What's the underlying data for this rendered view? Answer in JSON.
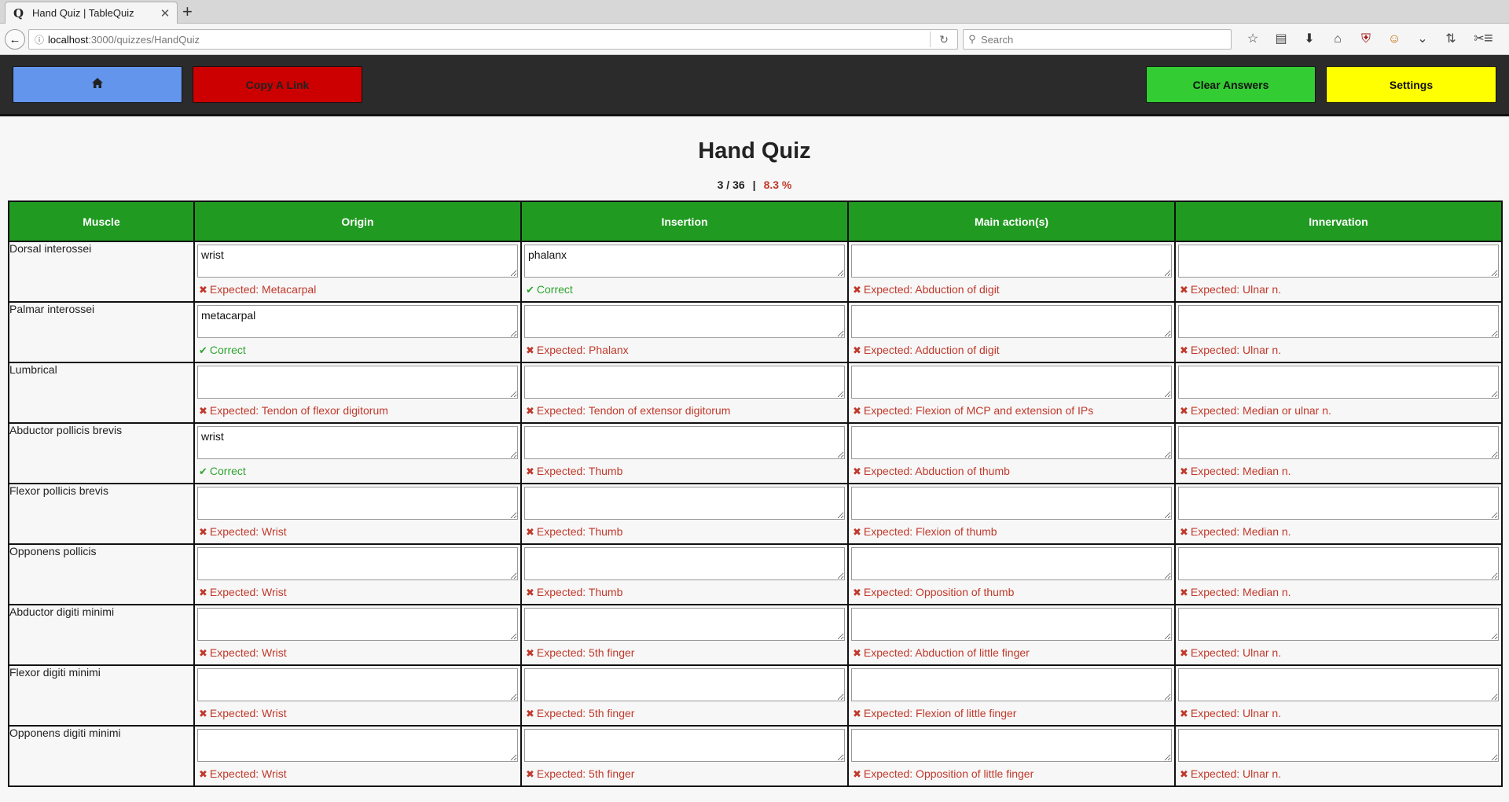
{
  "browser": {
    "tab_title": "Hand Quiz | TableQuiz",
    "tab_favicon": "Q",
    "url_host": "localhost",
    "url_path": ":3000/quizzes/HandQuiz",
    "search_placeholder": "Search"
  },
  "header": {
    "home_icon": "home-icon",
    "copy_label": "Copy A Link",
    "clear_label": "Clear Answers",
    "settings_label": "Settings"
  },
  "quiz": {
    "title": "Hand Quiz",
    "score": "3 / 36",
    "separator": "|",
    "percent": "8.3 %"
  },
  "table": {
    "columns": [
      "Muscle",
      "Origin",
      "Insertion",
      "Main action(s)",
      "Innervation"
    ],
    "rows": [
      {
        "muscle": "Dorsal interossei",
        "cells": [
          {
            "value": "wrist",
            "correct": false,
            "feedback": "Expected: Metacarpal"
          },
          {
            "value": "phalanx",
            "correct": true,
            "feedback": "Correct"
          },
          {
            "value": "",
            "correct": false,
            "feedback": "Expected: Abduction of digit"
          },
          {
            "value": "",
            "correct": false,
            "feedback": "Expected: Ulnar n."
          }
        ]
      },
      {
        "muscle": "Palmar interossei",
        "cells": [
          {
            "value": "metacarpal",
            "correct": true,
            "feedback": "Correct"
          },
          {
            "value": "",
            "correct": false,
            "feedback": "Expected: Phalanx"
          },
          {
            "value": "",
            "correct": false,
            "feedback": "Expected: Adduction of digit"
          },
          {
            "value": "",
            "correct": false,
            "feedback": "Expected: Ulnar n."
          }
        ]
      },
      {
        "muscle": "Lumbrical",
        "cells": [
          {
            "value": "",
            "correct": false,
            "feedback": "Expected: Tendon of flexor digitorum"
          },
          {
            "value": "",
            "correct": false,
            "feedback": "Expected: Tendon of extensor digitorum"
          },
          {
            "value": "",
            "correct": false,
            "feedback": "Expected: Flexion of MCP and extension of IPs"
          },
          {
            "value": "",
            "correct": false,
            "feedback": "Expected: Median or ulnar n."
          }
        ]
      },
      {
        "muscle": "Abductor pollicis brevis",
        "cells": [
          {
            "value": "wrist",
            "correct": true,
            "feedback": "Correct"
          },
          {
            "value": "",
            "correct": false,
            "feedback": "Expected: Thumb"
          },
          {
            "value": "",
            "correct": false,
            "feedback": "Expected: Abduction of thumb"
          },
          {
            "value": "",
            "correct": false,
            "feedback": "Expected: Median n."
          }
        ]
      },
      {
        "muscle": "Flexor pollicis brevis",
        "cells": [
          {
            "value": "",
            "correct": false,
            "feedback": "Expected: Wrist"
          },
          {
            "value": "",
            "correct": false,
            "feedback": "Expected: Thumb"
          },
          {
            "value": "",
            "correct": false,
            "feedback": "Expected: Flexion of thumb"
          },
          {
            "value": "",
            "correct": false,
            "feedback": "Expected: Median n."
          }
        ]
      },
      {
        "muscle": "Opponens pollicis",
        "cells": [
          {
            "value": "",
            "correct": false,
            "feedback": "Expected: Wrist"
          },
          {
            "value": "",
            "correct": false,
            "feedback": "Expected: Thumb"
          },
          {
            "value": "",
            "correct": false,
            "feedback": "Expected: Opposition of thumb"
          },
          {
            "value": "",
            "correct": false,
            "feedback": "Expected: Median n."
          }
        ]
      },
      {
        "muscle": "Abductor digiti minimi",
        "cells": [
          {
            "value": "",
            "correct": false,
            "feedback": "Expected: Wrist"
          },
          {
            "value": "",
            "correct": false,
            "feedback": "Expected: 5th finger"
          },
          {
            "value": "",
            "correct": false,
            "feedback": "Expected: Abduction of little finger"
          },
          {
            "value": "",
            "correct": false,
            "feedback": "Expected: Ulnar n."
          }
        ]
      },
      {
        "muscle": "Flexor digiti minimi",
        "cells": [
          {
            "value": "",
            "correct": false,
            "feedback": "Expected: Wrist"
          },
          {
            "value": "",
            "correct": false,
            "feedback": "Expected: 5th finger"
          },
          {
            "value": "",
            "correct": false,
            "feedback": "Expected: Flexion of little finger"
          },
          {
            "value": "",
            "correct": false,
            "feedback": "Expected: Ulnar n."
          }
        ]
      },
      {
        "muscle": "Opponens digiti minimi",
        "cells": [
          {
            "value": "",
            "correct": false,
            "feedback": "Expected: Wrist"
          },
          {
            "value": "",
            "correct": false,
            "feedback": "Expected: 5th finger"
          },
          {
            "value": "",
            "correct": false,
            "feedback": "Expected: Opposition of little finger"
          },
          {
            "value": "",
            "correct": false,
            "feedback": "Expected: Ulnar n."
          }
        ]
      }
    ]
  },
  "colors": {
    "header_bg": "#2b2b2b",
    "home_button": "#6495ed",
    "copy_button": "#cc0000",
    "clear_button": "#33cc33",
    "settings_button": "#ffff00",
    "table_header": "#219a21",
    "wrong": "#c0392b",
    "correct": "#2ea42e"
  }
}
